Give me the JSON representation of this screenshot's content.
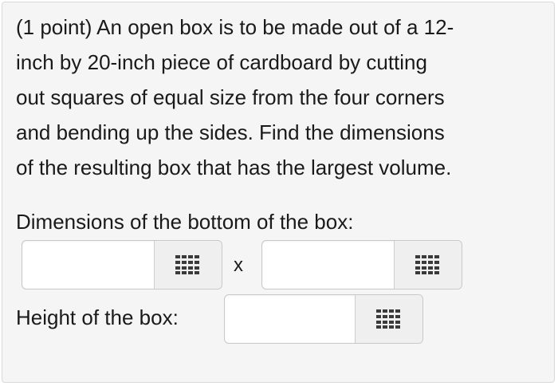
{
  "problem": {
    "lines": [
      "(1 point) An open box is to be made out of a 12-",
      "inch by 20-inch piece of cardboard by cutting",
      "out squares of equal size from the four corners",
      "and bending up the sides. Find the dimensions",
      "of the resulting box that has the largest volume."
    ]
  },
  "bottom_dimensions": {
    "label": "Dimensions of the bottom of the box:",
    "first_value": "",
    "separator": "x",
    "second_value": ""
  },
  "height": {
    "label": "Height of the box:",
    "value": ""
  },
  "icons": {
    "keypad": "keypad-grid-icon"
  }
}
